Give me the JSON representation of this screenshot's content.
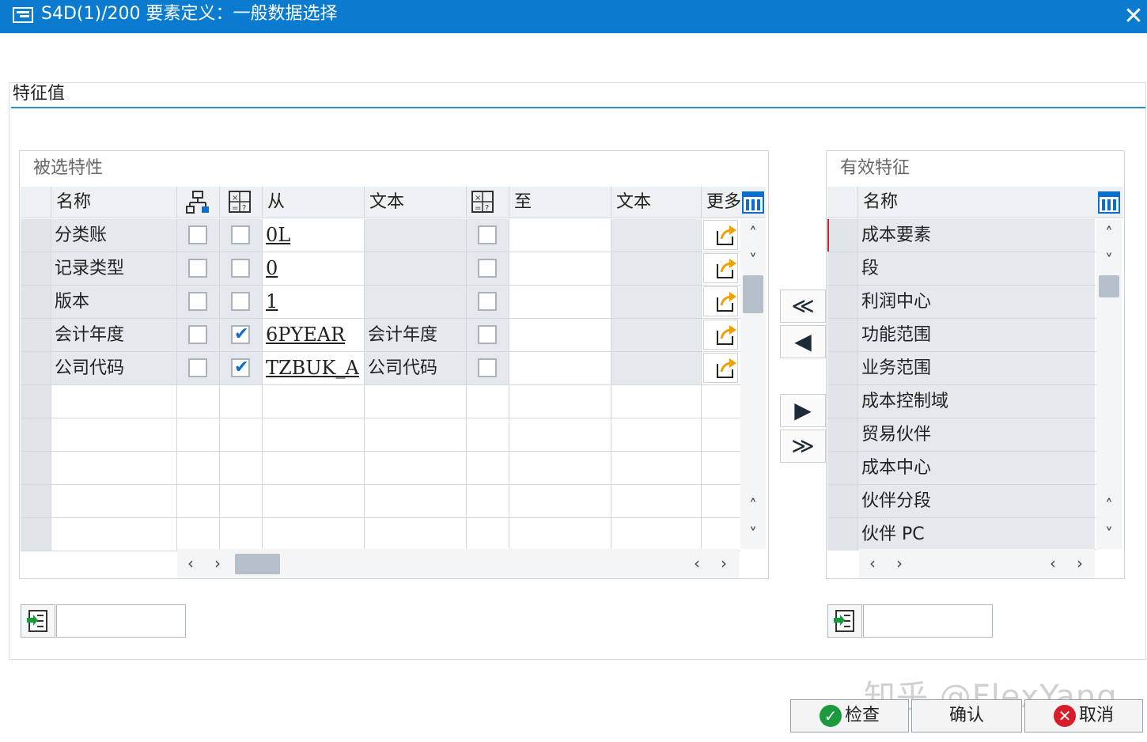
{
  "window": {
    "title": "S4D(1)/200 要素定义：一般数据选择",
    "close_glyph": "✕"
  },
  "group": {
    "title": "特征值"
  },
  "selected_panel": {
    "title": "被选特性",
    "headers": {
      "name": "名称",
      "from": "从",
      "text1": "文本",
      "to": "至",
      "text2": "文本",
      "more": "更多"
    },
    "rows": [
      {
        "name": "分类账",
        "hier": false,
        "var_from": false,
        "from": "0L",
        "text1": "",
        "var_to": false,
        "to": "",
        "text2": ""
      },
      {
        "name": "记录类型",
        "hier": false,
        "var_from": false,
        "from": "0",
        "text1": "",
        "var_to": false,
        "to": "",
        "text2": ""
      },
      {
        "name": "版本",
        "hier": false,
        "var_from": false,
        "from": "1",
        "text1": "",
        "var_to": false,
        "to": "",
        "text2": ""
      },
      {
        "name": "会计年度",
        "hier": false,
        "var_from": true,
        "from": "6PYEAR",
        "text1": "会计年度",
        "var_to": false,
        "to": "",
        "text2": ""
      },
      {
        "name": "公司代码",
        "hier": false,
        "var_from": true,
        "from": "TZBUK_A",
        "text1": "公司代码",
        "var_to": false,
        "to": "",
        "text2": ""
      }
    ],
    "empty_rows": 5,
    "icons": [
      "hierarchy-icon",
      "variable-icon",
      "variable-icon",
      "column-settings-icon",
      "details-icon"
    ],
    "colors": {
      "accent": "#0a6ed1",
      "detail_arrow": "#f0a000"
    }
  },
  "move_buttons": [
    {
      "glyph": "≪",
      "name": "move-all-left-button"
    },
    {
      "glyph": "◀",
      "name": "move-left-button"
    },
    {
      "glyph": "▶",
      "name": "move-right-button"
    },
    {
      "glyph": "≫",
      "name": "move-all-right-button"
    }
  ],
  "available_panel": {
    "title": "有效特征",
    "header_name": "名称",
    "items": [
      "成本要素",
      "段",
      "利润中心",
      "功能范围",
      "业务范围",
      "成本控制域",
      "贸易伙伴",
      "成本中心",
      "伙伴分段",
      "伙伴 PC"
    ],
    "icons": [
      "column-settings-icon"
    ]
  },
  "footer": {
    "check": "检查",
    "confirm": "确认",
    "cancel": "取消",
    "colors": {
      "check": "#1b9a3b",
      "cancel": "#d91c2a",
      "title_bar": "#0b7bd0"
    }
  },
  "watermark": "知乎 @FlexYang"
}
